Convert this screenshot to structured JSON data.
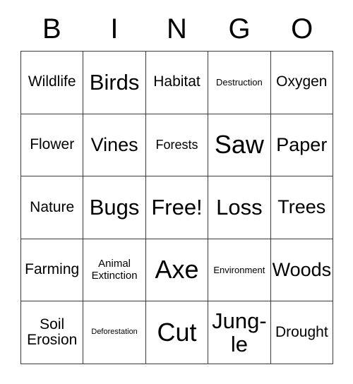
{
  "card": {
    "title": "Bingo Card",
    "header_letters": [
      "B",
      "I",
      "N",
      "G",
      "O"
    ],
    "colors": {
      "background": "#ffffff",
      "border": "#3b3b3b",
      "text": "#000000"
    },
    "rows": [
      [
        {
          "label": "Wildlife",
          "size": "m"
        },
        {
          "label": "Birds",
          "size": "xl"
        },
        {
          "label": "Habitat",
          "size": "m"
        },
        {
          "label": "Destruction",
          "size": "xxs"
        },
        {
          "label": "Oxygen",
          "size": "m"
        }
      ],
      [
        {
          "label": "Flower",
          "size": "m"
        },
        {
          "label": "Vines",
          "size": "l"
        },
        {
          "label": "Forests",
          "size": "s"
        },
        {
          "label": "Saw",
          "size": "xxl"
        },
        {
          "label": "Paper",
          "size": "l"
        }
      ],
      [
        {
          "label": "Nature",
          "size": "m"
        },
        {
          "label": "Bugs",
          "size": "xl"
        },
        {
          "label": "Free!",
          "size": "xl"
        },
        {
          "label": "Loss",
          "size": "xl"
        },
        {
          "label": "Trees",
          "size": "l"
        }
      ],
      [
        {
          "label": "Farming",
          "size": "m"
        },
        {
          "label": "Animal\nExtinction",
          "size": "xs"
        },
        {
          "label": "Axe",
          "size": "xxl"
        },
        {
          "label": "Environment",
          "size": "xxs"
        },
        {
          "label": "Woods",
          "size": "l"
        }
      ],
      [
        {
          "label": "Soil\nErosion",
          "size": "m"
        },
        {
          "label": "Deforestation",
          "size": "tiny"
        },
        {
          "label": "Cut",
          "size": "xxl"
        },
        {
          "label": "Jung-\nle",
          "size": "xl"
        },
        {
          "label": "Drought",
          "size": "m"
        }
      ]
    ]
  }
}
